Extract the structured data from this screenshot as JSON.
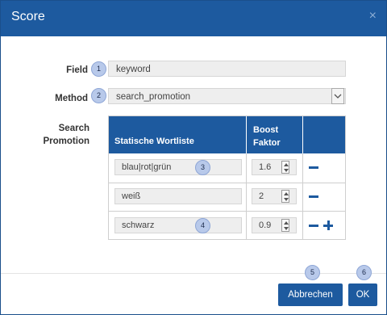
{
  "dialog": {
    "title": "Score",
    "close_glyph": "×"
  },
  "form": {
    "field_label": "Field",
    "field_value": "keyword",
    "method_label": "Method",
    "method_value": "search_promotion",
    "search_label_line1": "Search",
    "search_label_line2": "Promotion"
  },
  "badges": [
    "1",
    "2",
    "3",
    "4",
    "5",
    "6"
  ],
  "table": {
    "col1_header": "Statische Wortliste",
    "col2_header_line1": "Boost",
    "col2_header_line2": "Faktor",
    "rows": [
      {
        "word": "blau|rot|grün",
        "boost": "1.6"
      },
      {
        "word": "weiß",
        "boost": "2"
      },
      {
        "word": "schwarz",
        "boost": "0.9"
      }
    ]
  },
  "footer": {
    "cancel_label": "Abbrechen",
    "ok_label": "OK"
  },
  "colors": {
    "primary": "#1d5a9f",
    "badge": "#b8c9ea",
    "input_bg": "#eeeeee"
  },
  "icons": [
    "close-icon",
    "chevron-down-icon",
    "minus-icon",
    "plus-icon",
    "spinner-icon"
  ]
}
